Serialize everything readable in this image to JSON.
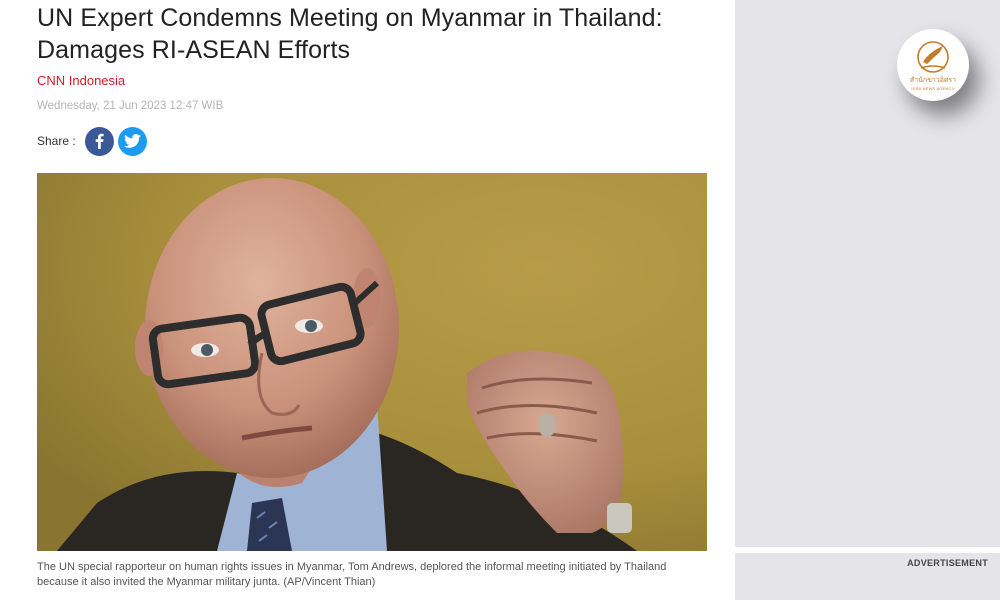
{
  "article": {
    "title": "UN Expert Condemns Meeting on Myanmar in Thailand: Damages RI-ASEAN Efforts",
    "source": "CNN Indonesia",
    "date": "Wednesday, 21 Jun 2023 12:47 WIB",
    "share_label": "Share :",
    "share_buttons": [
      "facebook-icon",
      "twitter-icon"
    ],
    "caption": "The UN special rapporteur on human rights issues in Myanmar, Tom Andrews, deplored the informal meeting initiated by Thailand because it also invited the Myanmar military junta. (AP/Vincent Thian)"
  },
  "sidebar": {
    "ad_label": "ADVERTISEMENT",
    "logo_text_th": "สำนักข่าวอิศรา",
    "logo_text_en": "ISRA NEWS AGENCY"
  },
  "colors": {
    "source_red": "#cc1f26",
    "facebook": "#3b5998",
    "twitter": "#1d9bf0",
    "sidebar_bg": "#e4e4e9",
    "logo_gold": "#c47b2a"
  }
}
